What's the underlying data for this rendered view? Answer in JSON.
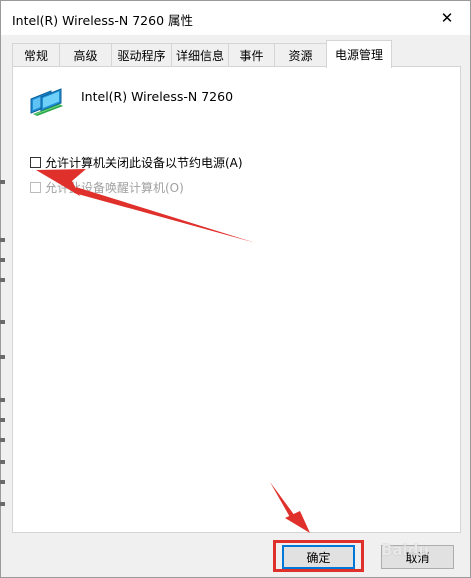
{
  "window": {
    "title": "Intel(R) Wireless-N 7260 属性",
    "close_glyph": "✕"
  },
  "tabs": [
    {
      "label": "常规",
      "active": false
    },
    {
      "label": "高级",
      "active": false
    },
    {
      "label": "驱动程序",
      "active": false
    },
    {
      "label": "详细信息",
      "active": false
    },
    {
      "label": "事件",
      "active": false
    },
    {
      "label": "资源",
      "active": false
    },
    {
      "label": "电源管理",
      "active": true
    }
  ],
  "panel": {
    "device_name": "Intel(R) Wireless-N 7260",
    "device_icon": "network-adapter-icon",
    "options": [
      {
        "label": "允许计算机关闭此设备以节约电源(A)",
        "checked": false,
        "enabled": true
      },
      {
        "label": "允许此设备唤醒计算机(O)",
        "checked": false,
        "enabled": false
      }
    ]
  },
  "buttons": {
    "ok_label": "确定",
    "cancel_label": "取消"
  },
  "watermark": "Baidu",
  "colors": {
    "annotation_red": "#e0302c",
    "focus_blue": "#0078d7"
  }
}
